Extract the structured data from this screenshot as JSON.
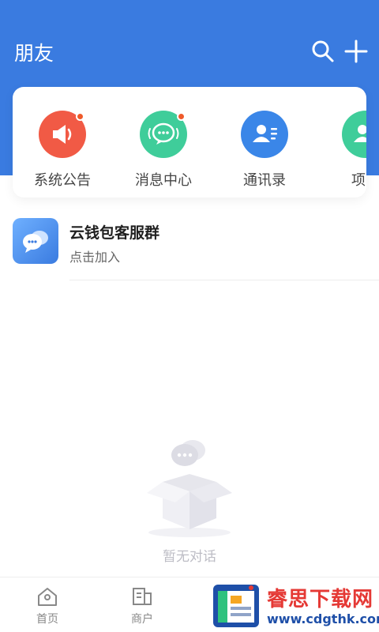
{
  "header": {
    "title": "朋友",
    "search_icon": "search-icon",
    "add_icon": "plus-icon"
  },
  "quick_entries": [
    {
      "label": "系统公告",
      "icon": "megaphone-icon",
      "color": "#f15a45",
      "badge": true
    },
    {
      "label": "消息中心",
      "icon": "chat-bubble-icon",
      "color": "#3fcd9a",
      "badge": true
    },
    {
      "label": "通讯录",
      "icon": "contacts-icon",
      "color": "#3a86e8",
      "badge": false
    },
    {
      "label": "项目",
      "icon": "group-icon",
      "color": "#3fcd9a",
      "badge": false
    }
  ],
  "group": {
    "name": "云钱包客服群",
    "subtitle": "点击加入",
    "icon": "chat-group-icon"
  },
  "empty_state": {
    "text": "暂无对话",
    "icon": "empty-box-icon"
  },
  "tabbar": [
    {
      "label": "首页",
      "icon": "home-icon"
    },
    {
      "label": "商户",
      "icon": "merchant-icon"
    }
  ],
  "watermark": {
    "title": "睿思下载网",
    "url": "www.cdgthk.com"
  },
  "colors": {
    "primary": "#3a7be0",
    "badge": "#ef5a2a"
  }
}
